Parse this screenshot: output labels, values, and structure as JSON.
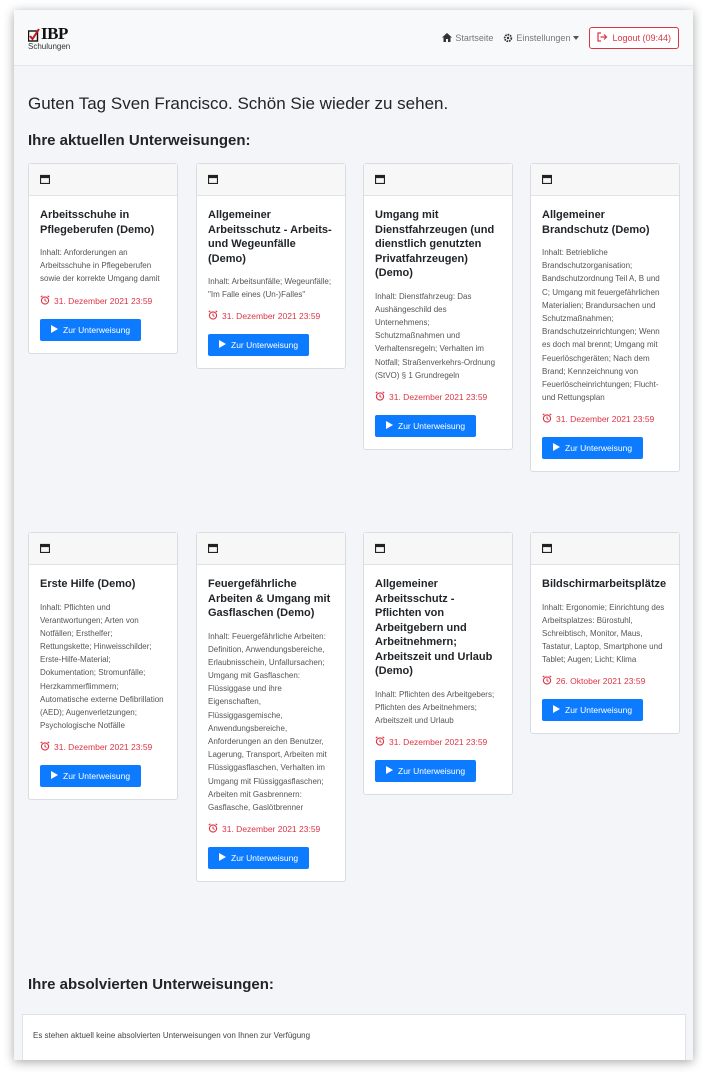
{
  "brand": {
    "logo_main": "IBP",
    "logo_sub": "Schulungen"
  },
  "nav": {
    "home_label": "Startseite",
    "settings_label": "Einstellungen",
    "logout_label": "Logout (09:44)"
  },
  "greeting": "Guten Tag Sven Francisco. Schön Sie wieder zu sehen.",
  "current_title": "Ihre aktuellen Unterweisungen:",
  "button_label": "Zur Unterweisung",
  "cards": [
    {
      "title": "Arbeitsschuhe in Pflegeberufen (Demo)",
      "content": "Inhalt: Anforderungen an Arbeitsschuhe in Pflegeberufen sowie der korrekte Umgang damit",
      "deadline": "31. Dezember 2021 23:59"
    },
    {
      "title": "Allgemeiner Arbeitsschutz - Arbeits- und Wegeunfälle (Demo)",
      "content": "Inhalt: Arbeitsunfälle; Wegeunfälle; \"Im Falle eines (Un-)Falles\"",
      "deadline": "31. Dezember 2021 23:59"
    },
    {
      "title": "Umgang mit Dienstfahrzeugen (und dienstlich genutzten Privatfahrzeugen) (Demo)",
      "content": "Inhalt: Dienstfahrzeug: Das Aushängeschild des Unternehmens; Schutzmaßnahmen und Verhaltensregeln; Verhalten im Notfall; Straßenverkehrs-Ordnung (StVO) § 1 Grundregeln",
      "deadline": "31. Dezember 2021 23:59"
    },
    {
      "title": "Allgemeiner Brandschutz (Demo)",
      "content": "Inhalt: Betriebliche Brandschutzorganisation; Bandschutzordnung Teil A, B und C; Umgang mit feuergefährlichen Materialien; Brandursachen und Schutzmaßnahmen; Brandschutzeinrichtungen; Wenn es doch mal brennt; Umgang mit Feuerlöschgeräten; Nach dem Brand; Kennzeichnung von Feuerlöscheinrichtungen; Flucht- und Rettungsplan",
      "deadline": "31. Dezember 2021 23:59"
    },
    {
      "title": "Erste Hilfe (Demo)",
      "content": "Inhalt: Pflichten und Verantwortungen; Arten von Notfällen; Ersthelfer; Rettungskette; Hinweisschilder; Erste-Hilfe-Material; Dokumentation; Stromunfälle; Herzkammerflimmern; Automatische externe Defibrillation (AED); Augenverletzungen; Psychologische Notfälle",
      "deadline": "31. Dezember 2021 23:59"
    },
    {
      "title": "Feuergefährliche Arbeiten & Umgang mit Gasflaschen (Demo)",
      "content": "Inhalt: Feuergefährliche Arbeiten: Definition, Anwendungsbereiche, Erlaubnisschein, Unfallursachen; Umgang mit Gasflaschen: Flüssiggase und ihre Eigenschaften, Flüssiggasgemische, Anwendungsbereiche, Anforderungen an den Benutzer, Lagerung, Transport, Arbeiten mit Flüssiggasflaschen, Verhalten im Umgang mit Flüssiggasflaschen; Arbeiten mit Gasbrennern: Gasflasche, Gaslötbrenner",
      "deadline": "31. Dezember 2021 23:59"
    },
    {
      "title": "Allgemeiner Arbeitsschutz - Pflichten von Arbeitgebern und Arbeitnehmern; Arbeitszeit und Urlaub (Demo)",
      "content": "Inhalt: Pflichten des Arbeitgebers; Pflichten des Arbeitnehmers; Arbeitszeit und Urlaub",
      "deadline": "31. Dezember 2021 23:59"
    },
    {
      "title": "Bildschirmarbeitsplätze",
      "content": "Inhalt: Ergonomie; Einrichtung des Arbeitsplatzes: Bürostuhl, Schreibtisch, Monitor, Maus, Tastatur, Laptop, Smartphone und Tablet; Augen; Licht; Klima",
      "deadline": "26. Oktober 2021 23:59"
    }
  ],
  "absolved_title": "Ihre absolvierten Unterweisungen:",
  "absolved_empty": "Es stehen aktuell keine absolvierten Unterweisungen von Ihnen zur Verfügung",
  "colors": {
    "primary": "#0d7bff",
    "danger": "#dc3545",
    "logo_red": "#c4161c"
  }
}
